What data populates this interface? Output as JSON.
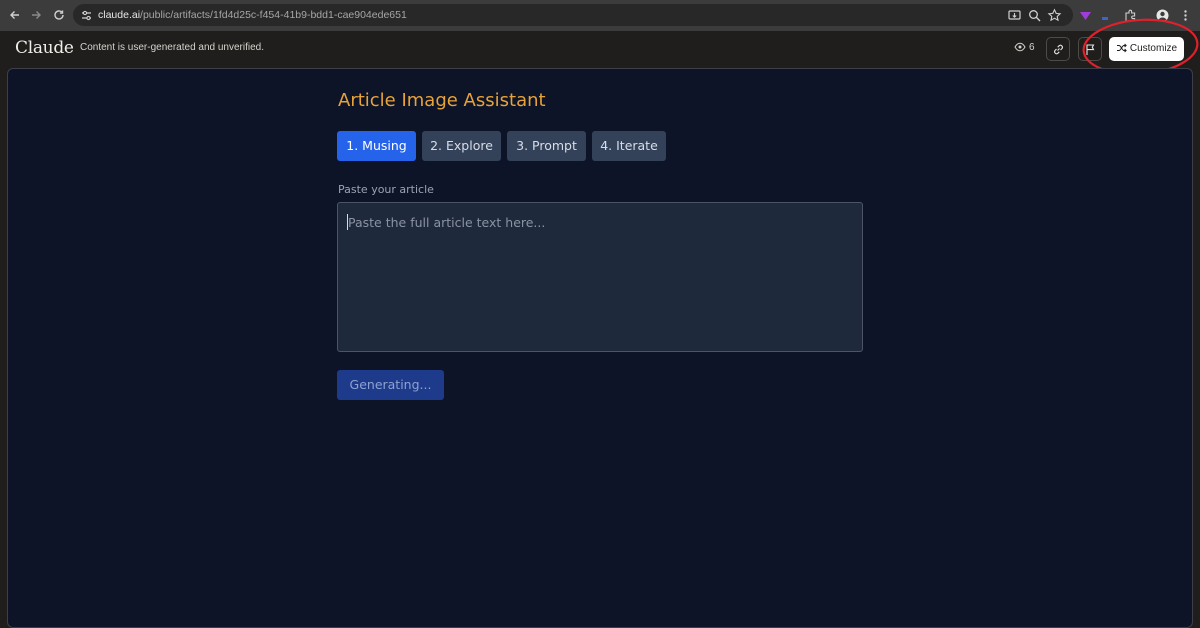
{
  "browser": {
    "url_host": "claude.ai",
    "url_path": "/public/artifacts/1fd4d25c-f454-41b9-bdd1-cae904ede651",
    "icons": [
      "back-icon",
      "forward-icon",
      "reload-icon",
      "site-settings-icon",
      "install-icon",
      "zoom-icon",
      "bookmark-star-icon",
      "extension-icon",
      "extensions-puzzle-icon",
      "profile-icon",
      "menu-icon"
    ]
  },
  "header": {
    "logo": "Claude",
    "notice": "Content is user-generated and unverified.",
    "view_count": "6",
    "customize_label": "Customize"
  },
  "app": {
    "title": "Article Image Assistant",
    "tabs": [
      {
        "label": "1. Musing",
        "active": true
      },
      {
        "label": "2. Explore",
        "active": false
      },
      {
        "label": "3. Prompt",
        "active": false
      },
      {
        "label": "4. Iterate",
        "active": false
      }
    ],
    "article_label": "Paste your article",
    "article_placeholder": "Paste the full article text here...",
    "article_value": "",
    "generate_button": "Generating..."
  },
  "colors": {
    "accent": "#2563eb",
    "title": "#e8a23a",
    "background": "#0d1427",
    "annotation_circle": "#e0202a"
  }
}
